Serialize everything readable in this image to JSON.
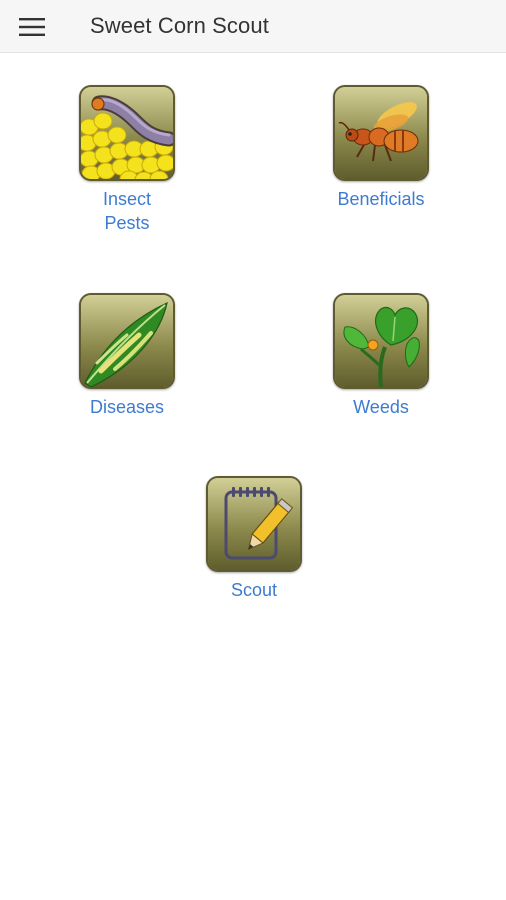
{
  "app_bar": {
    "title": "Sweet Corn Scout",
    "menu_icon": "hamburger-menu-icon"
  },
  "tiles": [
    {
      "label_line1": "Insect",
      "label_line2": "Pests",
      "icon": "caterpillar-on-corn-icon"
    },
    {
      "label": "Beneficials",
      "icon": "wasp-icon"
    },
    {
      "label": "Diseases",
      "icon": "diseased-leaf-icon"
    },
    {
      "label": "Weeds",
      "icon": "weed-plant-icon"
    },
    {
      "label": "Scout",
      "icon": "notepad-pencil-icon"
    }
  ],
  "colors": {
    "label_link": "#3d7bd0",
    "app_bar_bg": "#f6f6f6",
    "icon_frame": "#8c8a52"
  }
}
